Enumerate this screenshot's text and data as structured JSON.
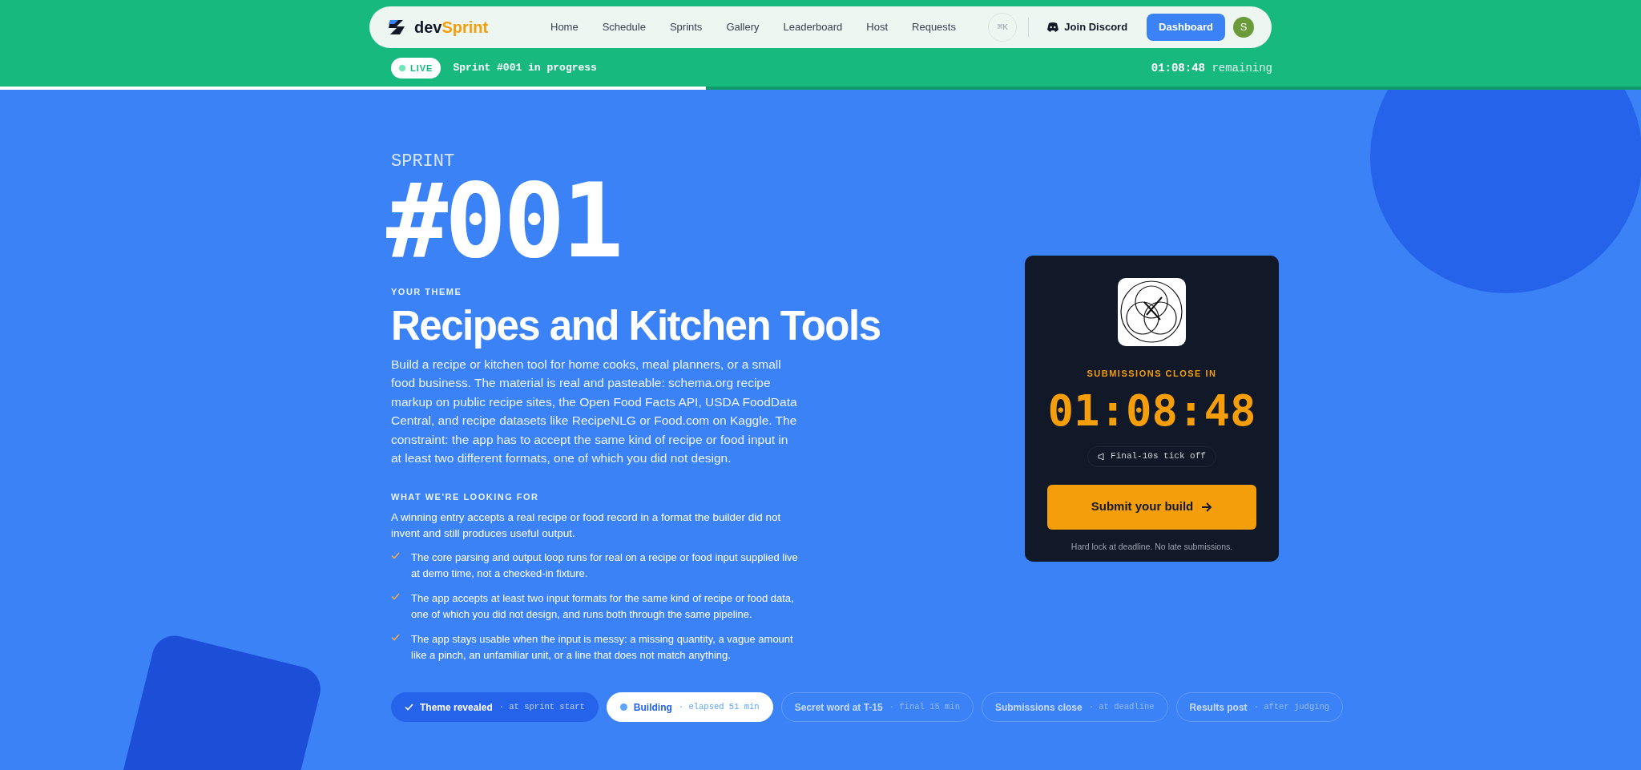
{
  "nav": {
    "logo": {
      "prefix": "dev",
      "suffix": "Sprint"
    },
    "links": [
      "Home",
      "Schedule",
      "Sprints",
      "Gallery",
      "Leaderboard",
      "Host",
      "Requests"
    ],
    "shortcut": "⌘K",
    "discord": "Join Discord",
    "dashboard": "Dashboard",
    "avatar": "S"
  },
  "live_bar": {
    "badge": "LIVE",
    "status": "Sprint #001 in progress",
    "time": "01:08:48",
    "time_suffix": "remaining",
    "level": 0.43
  },
  "hero": {
    "eyebrow": "SPRINT",
    "number": "#001",
    "theme_label": "YOUR THEME",
    "title": "Recipes and Kitchen Tools",
    "description": "Build a recipe or kitchen tool for home cooks, meal planners, or a small food business. The material is real and pasteable: schema.org recipe markup on public recipe sites, the Open Food Facts API, USDA FoodData Central, and recipe datasets like RecipeNLG or Food.com on Kaggle. The constraint: the app has to accept the same kind of recipe or food input in at least two different formats, one of which you did not design."
  },
  "criteria": {
    "heading": "WHAT WE'RE LOOKING FOR",
    "intro": "A winning entry accepts a real recipe or food record in a format the builder did not invent and still produces useful output.",
    "items": [
      "The core parsing and output loop runs for real on a recipe or food input supplied live at demo time, not a checked-in fixture.",
      "The app accepts at least two input formats for the same kind of recipe or food data, one of which you did not design, and runs both through the same pipeline.",
      "The app stays usable when the input is messy: a missing quantity, a vague amount like a pinch, an unfamiliar unit, or a line that does not match anything."
    ]
  },
  "timer_card": {
    "label": "SUBMISSIONS CLOSE IN",
    "time": "01:08:48",
    "sound_toggle": "Final-10s tick off",
    "submit": "Submit your build",
    "note": "Hard lock at deadline. No late submissions."
  },
  "timeline": [
    {
      "label": "Theme revealed",
      "note": "· at sprint start",
      "kind": "done"
    },
    {
      "label": "Building",
      "note": "· elapsed 51 min",
      "kind": "current"
    },
    {
      "label": "Secret word at T-15",
      "note": "· final 15 min",
      "kind": "upcoming"
    },
    {
      "label": "Submissions close",
      "note": "· at deadline",
      "kind": "upcoming"
    },
    {
      "label": "Results post",
      "note": "· after judging",
      "kind": "upcoming"
    }
  ]
}
